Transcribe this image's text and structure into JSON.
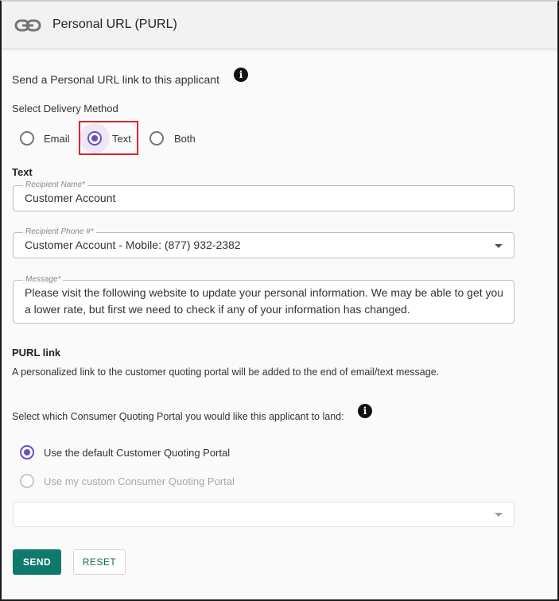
{
  "header": {
    "title": "Personal URL (PURL)",
    "icon": "link-icon"
  },
  "intro": {
    "text": "Send a Personal URL link to this applicant",
    "info": "i"
  },
  "delivery": {
    "label": "Select Delivery Method",
    "options": [
      {
        "label": "Email",
        "checked": false
      },
      {
        "label": "Text",
        "checked": true
      },
      {
        "label": "Both",
        "checked": false
      }
    ]
  },
  "text_section": {
    "title": "Text",
    "recipient_name": {
      "label": "Recipient Name*",
      "value": "Customer Account"
    },
    "recipient_phone": {
      "label": "Recipient Phone #*",
      "value": "Customer Account - Mobile: (877) 932-2382"
    },
    "message": {
      "label": "Message*",
      "value": "Please visit the following website to update your personal information. We may be able to get you a lower rate, but first we need to check if any of your information has changed."
    }
  },
  "purl": {
    "title": "PURL link",
    "description": "A personalized link to the customer quoting portal will be added to the end of email/text message."
  },
  "portal": {
    "label": "Select which Consumer Quoting Portal you would like this applicant to land:",
    "info": "i",
    "options": [
      {
        "label": "Use the default Customer Quoting Portal",
        "checked": true,
        "disabled": false
      },
      {
        "label": "Use my custom Consumer Quoting Portal",
        "checked": false,
        "disabled": true
      }
    ],
    "select_value": ""
  },
  "actions": {
    "send": "SEND",
    "reset": "RESET"
  },
  "colors": {
    "accent": "#6a4fc2",
    "primary_button": "#0f7a6b",
    "highlight": "#d9262c"
  }
}
